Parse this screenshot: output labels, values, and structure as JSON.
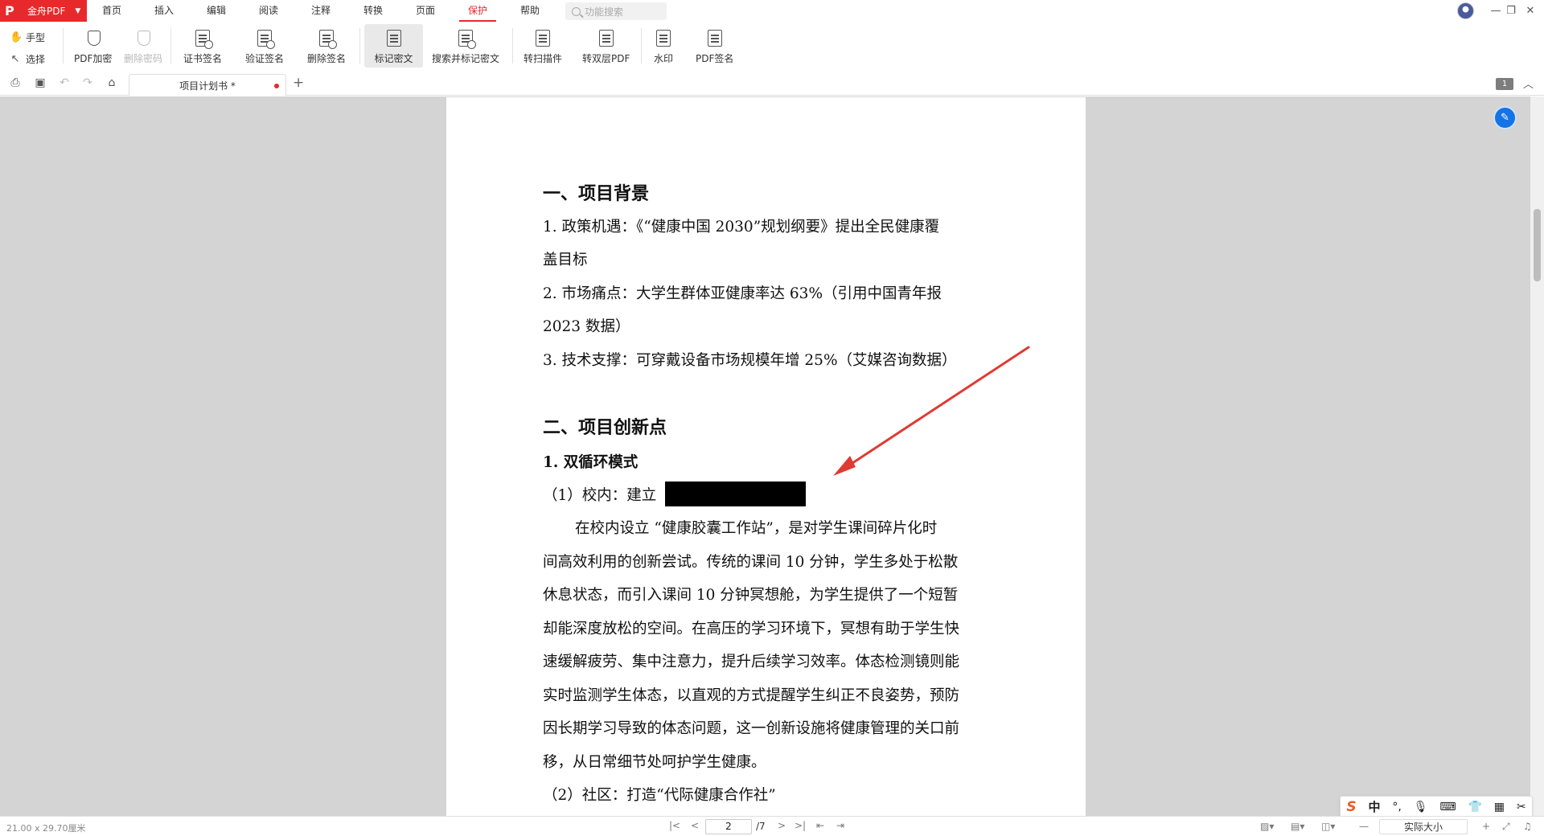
{
  "app": {
    "name": "金舟PDF",
    "accent": "#e8292b"
  },
  "menu": {
    "items": [
      "首页",
      "插入",
      "编辑",
      "阅读",
      "注释",
      "转换",
      "页面",
      "保护",
      "帮助"
    ],
    "active": "保护",
    "search_placeholder": "功能搜索"
  },
  "ribbon": {
    "hand": "手型",
    "select": "选择",
    "pdf_encrypt": "PDF加密",
    "remove_password": "删除密码",
    "cert_sign": "证书签名",
    "verify_sign": "验证签名",
    "delete_sign": "删除签名",
    "mark_redact": "标记密文",
    "search_mark_redact": "搜索并标记密文",
    "to_scan": "转扫描件",
    "to_dual_pdf": "转双层PDF",
    "watermark": "水印",
    "pdf_sign": "PDF签名"
  },
  "tabs": {
    "doc_title": "项目计划书 *",
    "page_badge": "1"
  },
  "document": {
    "heading1": "一、项目背景",
    "lines": [
      "1. 政策机遇：《“健康中国 2030”规划纲要》提出全民健康覆",
      "盖目标",
      "2. 市场痛点：大学生群体亚健康率达 63%（引用中国青年报",
      "2023 数据）",
      "3. 技术支撑：可穿戴设备市场规模年增 25%（艾媒咨询数据）"
    ],
    "heading2": "二、项目创新点",
    "sub1": "1. 双循环模式",
    "campus": "（1）校内：建立",
    "body": [
      "在校内设立 “健康胶囊工作站”，是对学生课间碎片化时",
      "间高效利用的创新尝试。传统的课间 10 分钟，学生多处于松散",
      "休息状态，而引入课间 10 分钟冥想舱，为学生提供了一个短暂",
      "却能深度放松的空间。在高压的学习环境下，冥想有助于学生快",
      "速缓解疲劳、集中注意力，提升后续学习效率。体态检测镜则能",
      "实时监测学生体态，以直观的方式提醒学生纠正不良姿势，预防",
      "因长期学习导致的体态问题，这一创新设施将健康管理的关口前",
      "移，从日常细节处呵护学生健康。"
    ],
    "community": "（2）社区：打造“代际健康合作社”"
  },
  "ime": {
    "mode": "中"
  },
  "status": {
    "page_size": "21.00 x 29.70厘米",
    "current_page": "2",
    "total_pages": "/7",
    "zoom": "实际大小"
  }
}
